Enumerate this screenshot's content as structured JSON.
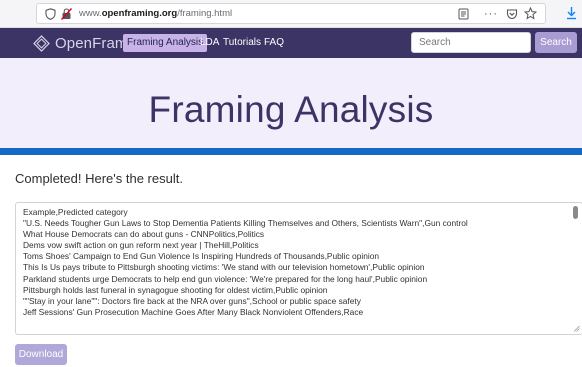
{
  "browser": {
    "url_prefix": "www.",
    "url_domain": "openframing.org",
    "url_path": "/framing.html"
  },
  "navbar": {
    "brand": "OpenFraming",
    "items": [
      {
        "label": "Framing Analysis",
        "active": true
      },
      {
        "label": "LDA",
        "active": false
      },
      {
        "label": "Tutorials",
        "active": false
      },
      {
        "label": "FAQ",
        "active": false
      }
    ],
    "search_placeholder": "Search",
    "search_button": "Search"
  },
  "hero": {
    "title": "Framing Analysis"
  },
  "main": {
    "status": "Completed! Here's the result.",
    "result_lines": [
      "Example,Predicted category",
      "\"U.S. Needs Tougher Gun Laws to Stop Dementia Patients Killing Themselves and Others, Scientists Warn\",Gun control",
      "What House Democrats can do about guns - CNNPolitics,Politics",
      "Dems vow swift action on gun reform next year | TheHill,Politics",
      "Toms Shoes' Campaign to End Gun Violence Is Inspiring Hundreds of Thousands,Public opinion",
      "This Is Us pays tribute to Pittsburgh shooting victims: 'We stand with our television hometown',Public opinion",
      "Parkland students urge Democrats to help end gun violence: 'We're prepared for the long haul',Public opinion",
      "Pittsburgh holds last funeral in synagogue shooting for oldest victim,Public opinion",
      "\"\"Stay in your lane\"\": Doctors fire back at the NRA over guns\",School or public space safety",
      "Jeff Sessions' Gun Prosecution Machine Goes After Many Black Nonviolent Offenders,Race"
    ],
    "download_label": "Download"
  },
  "colors": {
    "navbar": "#3b3465",
    "hero_bg": "#f3eefb",
    "accent_bar": "#1469c7",
    "active_nav": "#c7b3e8",
    "button": "#a99cd2"
  }
}
